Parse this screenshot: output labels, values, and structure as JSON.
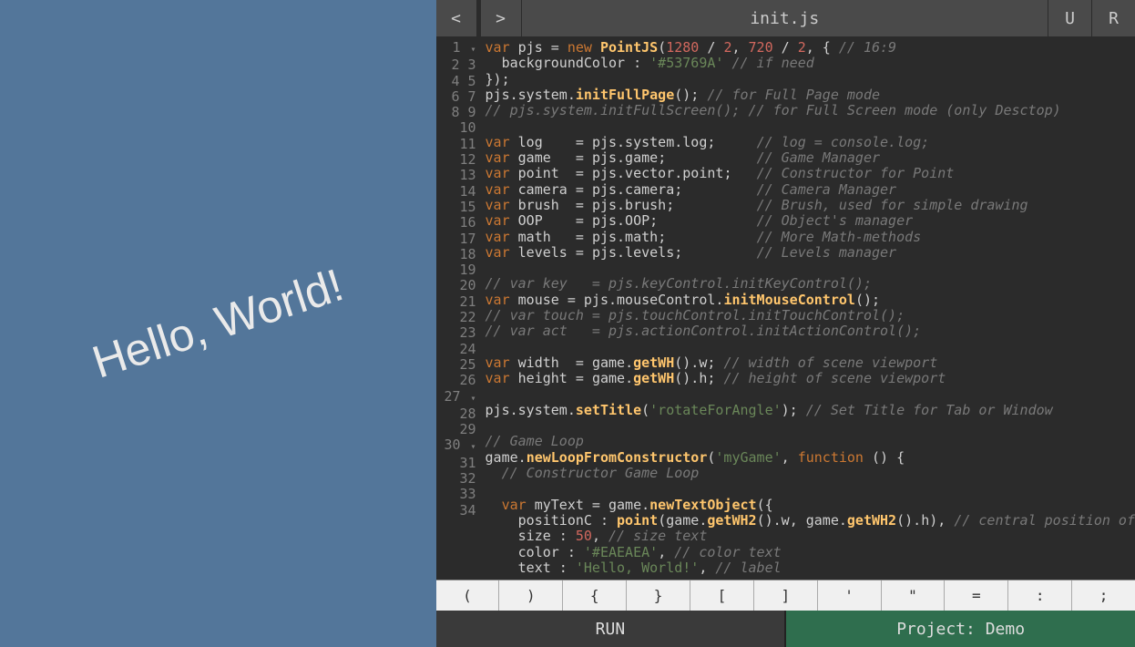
{
  "preview": {
    "text": "Hello, World!"
  },
  "tabbar": {
    "back": "<",
    "forward": ">",
    "filename": "init.js",
    "btn_u": "U",
    "btn_r": "R"
  },
  "symbols": [
    "(",
    ")",
    "{",
    "}",
    "[",
    "]",
    "'",
    "\"",
    "=",
    ":",
    ";"
  ],
  "footer": {
    "run": "RUN",
    "project": "Project: Demo"
  },
  "code": {
    "lines": 34,
    "content_summary": "PointJS init script creating a rotated 'Hello, World!' text object",
    "values": {
      "canvas_w_expr": "1280 / 2",
      "canvas_h_expr": "720 / 2",
      "aspect_comment": "16:9",
      "backgroundColor": "#53769A",
      "title": "rotateForAngle",
      "loopName": "myGame",
      "text_size": 50,
      "text_color": "#EAEAEA",
      "text_label": "Hello, World!"
    }
  }
}
